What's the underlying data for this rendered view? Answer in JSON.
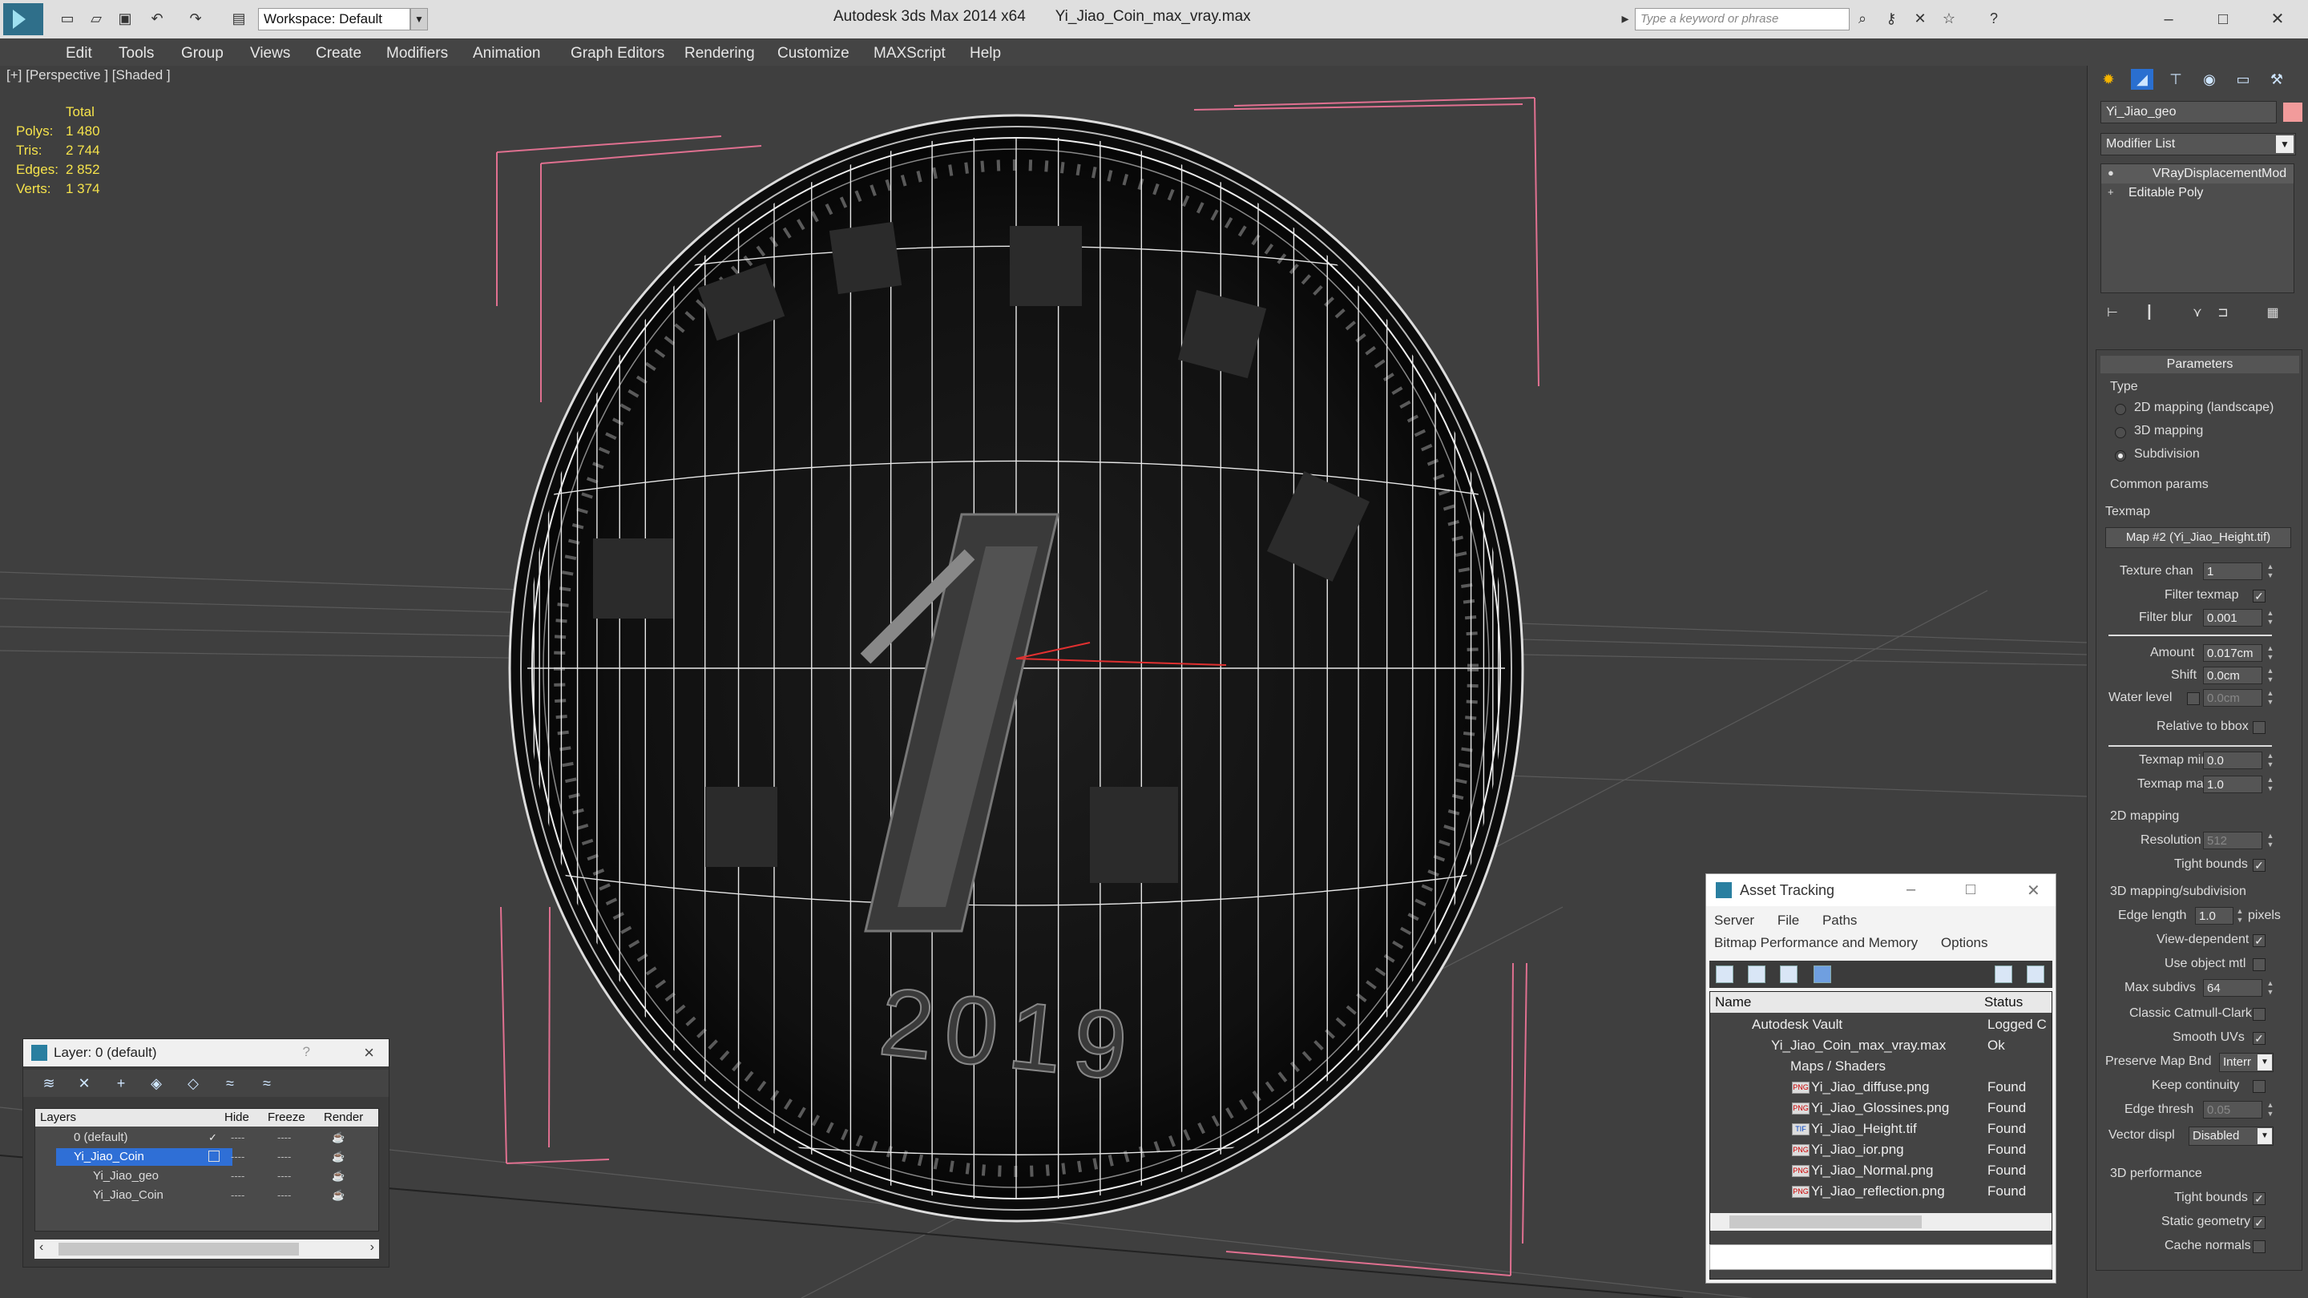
{
  "titlebar": {
    "workspace": "Workspace: Default",
    "app_title": "Autodesk 3ds Max  2014 x64",
    "file_title": "Yi_Jiao_Coin_max_vray.max",
    "search_placeholder": "Type a keyword or phrase"
  },
  "menu": [
    "Edit",
    "Tools",
    "Group",
    "Views",
    "Create",
    "Modifiers",
    "Animation",
    "Graph Editors",
    "Rendering",
    "Customize",
    "MAXScript",
    "Help"
  ],
  "viewport": {
    "label": "[+] [Perspective ] [Shaded ]",
    "stats": {
      "header": "Total",
      "polys_label": "Polys:",
      "polys": "1 480",
      "tris_label": "Tris:",
      "tris": "2 744",
      "edges_label": "Edges:",
      "edges": "2 852",
      "verts_label": "Verts:",
      "verts": "1 374"
    },
    "coin_year_text": "2019"
  },
  "layer_panel": {
    "title": "Layer: 0 (default)",
    "help": "?",
    "columns": {
      "layers": "Layers",
      "hide": "Hide",
      "freeze": "Freeze",
      "render": "Render"
    },
    "rows": [
      {
        "name": "0 (default)",
        "selected": false
      },
      {
        "name": "Yi_Jiao_Coin",
        "selected": true
      },
      {
        "name": "Yi_Jiao_geo",
        "selected": false
      },
      {
        "name": "Yi_Jiao_Coin",
        "selected": false
      }
    ],
    "dashes": "----"
  },
  "asset_panel": {
    "title": "Asset Tracking",
    "menu1": [
      "Server",
      "File",
      "Paths"
    ],
    "menu2": [
      "Bitmap Performance and Memory",
      "Options"
    ],
    "columns": {
      "name": "Name",
      "status": "Status"
    },
    "rows": [
      {
        "name": "Autodesk Vault",
        "status": "Logged C"
      },
      {
        "name": "Yi_Jiao_Coin_max_vray.max",
        "status": "Ok"
      },
      {
        "name": "Maps / Shaders",
        "status": ""
      },
      {
        "name": "Yi_Jiao_diffuse.png",
        "status": "Found",
        "ext": "PNG"
      },
      {
        "name": "Yi_Jiao_Glossines.png",
        "status": "Found",
        "ext": "PNG"
      },
      {
        "name": "Yi_Jiao_Height.tif",
        "status": "Found",
        "ext": "TIF"
      },
      {
        "name": "Yi_Jiao_ior.png",
        "status": "Found",
        "ext": "PNG"
      },
      {
        "name": "Yi_Jiao_Normal.png",
        "status": "Found",
        "ext": "PNG"
      },
      {
        "name": "Yi_Jiao_reflection.png",
        "status": "Found",
        "ext": "PNG"
      }
    ]
  },
  "command_panel": {
    "object_name": "Yi_Jiao_geo",
    "object_color": "#f29b9b",
    "modifier_list": "Modifier List",
    "stack": [
      "VRayDisplacementMod",
      "Editable Poly"
    ],
    "parameters_header": "Parameters",
    "type_label": "Type",
    "type_options": [
      "2D mapping (landscape)",
      "3D mapping",
      "Subdivision"
    ],
    "type_selected": 2,
    "common_params": "Common params",
    "texmap_label": "Texmap",
    "texmap_button": "Map #2 (Yi_Jiao_Height.tif)",
    "texture_chan_label": "Texture chan",
    "texture_chan": "1",
    "filter_texmap_label": "Filter texmap",
    "filter_blur_label": "Filter blur",
    "filter_blur": "0.001",
    "amount_label": "Amount",
    "amount": "0.017cm",
    "shift_label": "Shift",
    "shift": "0.0cm",
    "water_level_label": "Water level",
    "water_level": "0.0cm",
    "relative_bbox_label": "Relative to bbox",
    "texmap_min_label": "Texmap min",
    "texmap_min": "0.0",
    "texmap_max_label": "Texmap max",
    "texmap_max": "1.0",
    "mapping2d_label": "2D mapping",
    "resolution_label": "Resolution",
    "resolution": "512",
    "tight_bounds_label": "Tight bounds",
    "mapping3d_label": "3D mapping/subdivision",
    "edge_length_label": "Edge length",
    "edge_length": "1.0",
    "pixels_label": "pixels",
    "view_dependent_label": "View-dependent",
    "use_object_mtl_label": "Use object mtl",
    "max_subdivs_label": "Max subdivs",
    "max_subdivs": "64",
    "catmull_label": "Classic Catmull-Clark",
    "smooth_uvs_label": "Smooth UVs",
    "preserve_map_label": "Preserve Map Bnd",
    "preserve_map": "Interr",
    "keep_continuity_label": "Keep continuity",
    "edge_thresh_label": "Edge thresh",
    "edge_thresh": "0.05",
    "vector_displ_label": "Vector displ",
    "vector_displ": "Disabled",
    "perf_label": "3D performance",
    "tight_bounds2_label": "Tight bounds",
    "static_geometry_label": "Static geometry",
    "cache_normals_label": "Cache normals",
    "check_mark": "✓"
  }
}
